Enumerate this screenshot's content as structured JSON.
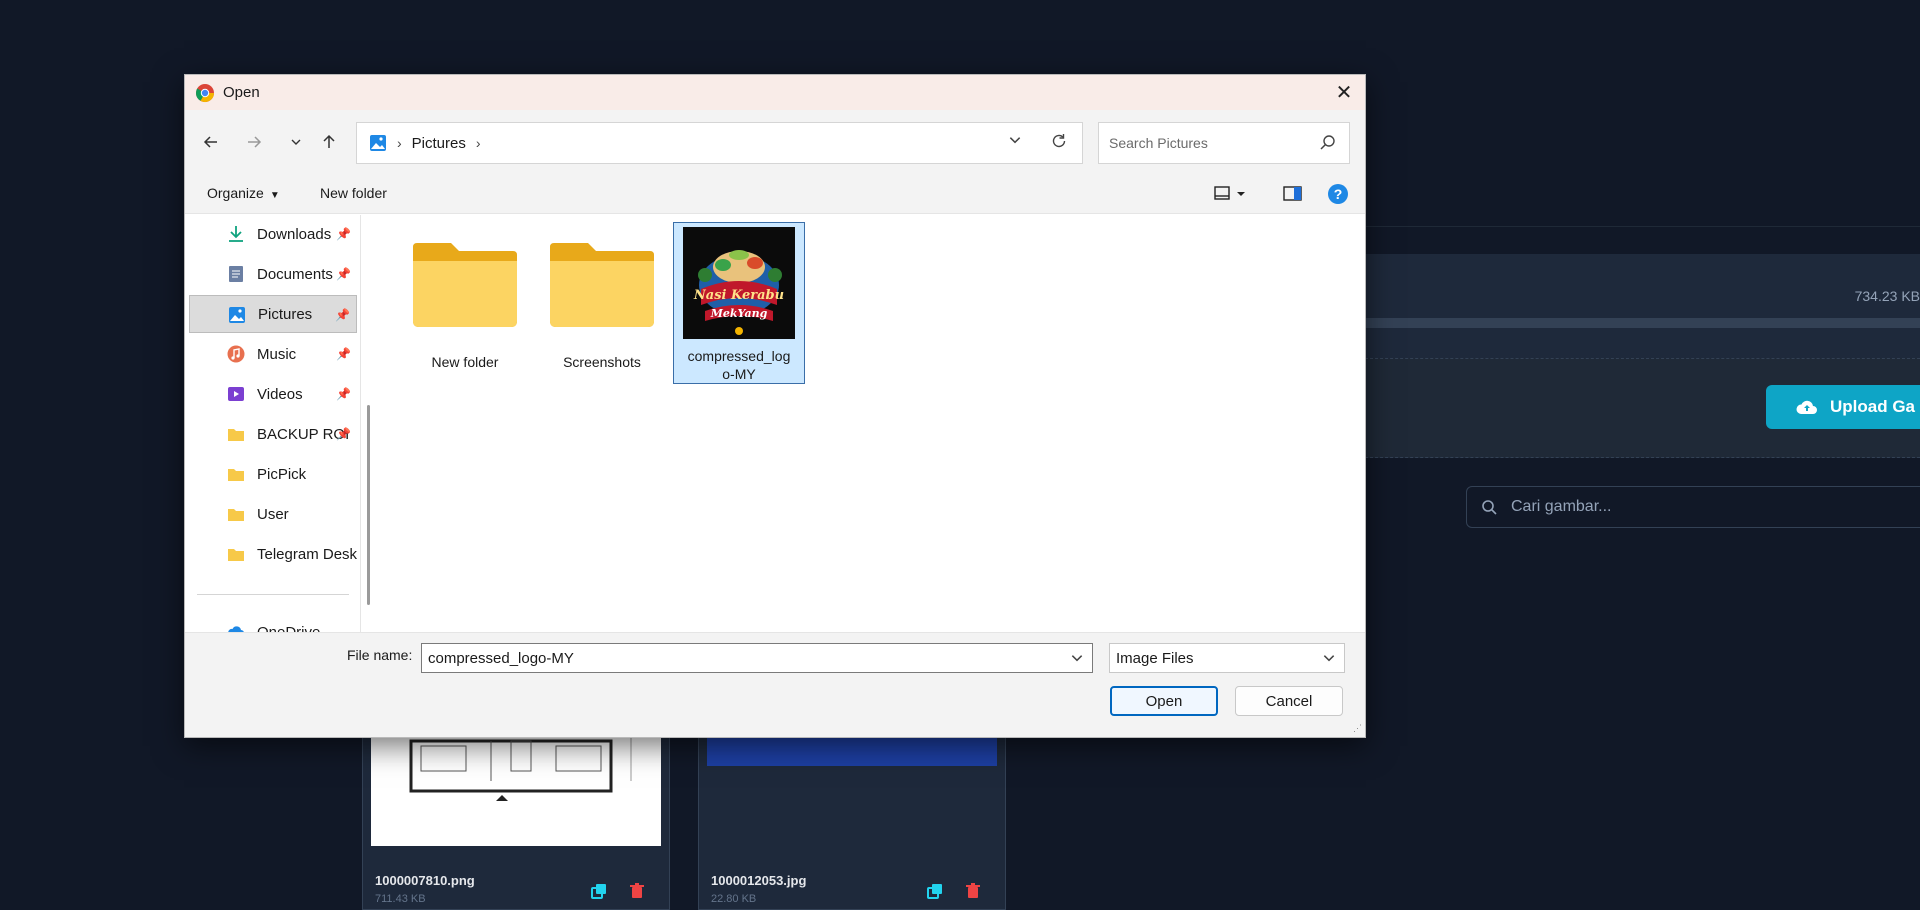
{
  "background_app": {
    "file_size": "734.23 KB",
    "upload_button_label": "Upload Ga",
    "search_placeholder": "Cari gambar...",
    "cards": [
      {
        "filename": "1000007810.png",
        "size": "711.43 KB"
      },
      {
        "filename": "1000012053.jpg",
        "size": "22.80 KB"
      }
    ]
  },
  "dialog": {
    "title": "Open",
    "breadcrumb": [
      "Pictures"
    ],
    "search_placeholder": "Search Pictures",
    "toolbar": {
      "organize_label": "Organize",
      "new_folder_label": "New folder"
    },
    "sidebar": {
      "items": [
        {
          "label": "Downloads",
          "icon": "download-icon",
          "pinned": true
        },
        {
          "label": "Documents",
          "icon": "documents-icon",
          "pinned": true
        },
        {
          "label": "Pictures",
          "icon": "pictures-icon",
          "pinned": true,
          "selected": true
        },
        {
          "label": "Music",
          "icon": "music-icon",
          "pinned": true
        },
        {
          "label": "Videos",
          "icon": "videos-icon",
          "pinned": true
        },
        {
          "label": "BACKUP ROI",
          "icon": "folder-icon",
          "pinned": true
        },
        {
          "label": "PicPick",
          "icon": "folder-icon",
          "pinned": false
        },
        {
          "label": "User",
          "icon": "folder-icon",
          "pinned": false
        },
        {
          "label": "Telegram Deskto",
          "icon": "folder-icon",
          "pinned": false
        }
      ],
      "partial_item": "OneDrive"
    },
    "files": [
      {
        "name": "New folder",
        "type": "folder"
      },
      {
        "name": "Screenshots",
        "type": "folder"
      },
      {
        "name_line1": "compressed_log",
        "name_line2": "o-MY",
        "type": "image",
        "selected": true,
        "thumb_text_1": "Nasi Kerabu",
        "thumb_text_2": "MekYang"
      }
    ],
    "file_name_label": "File name:",
    "file_name_value": "compressed_logo-MY",
    "file_type": "Image Files",
    "open_label": "Open",
    "cancel_label": "Cancel"
  },
  "colors": {
    "accent": "#0067c0",
    "selection": "#cce8ff",
    "folder": "#f7c948",
    "app_bg": "#111827",
    "upload_button": "#0ea5c6"
  }
}
